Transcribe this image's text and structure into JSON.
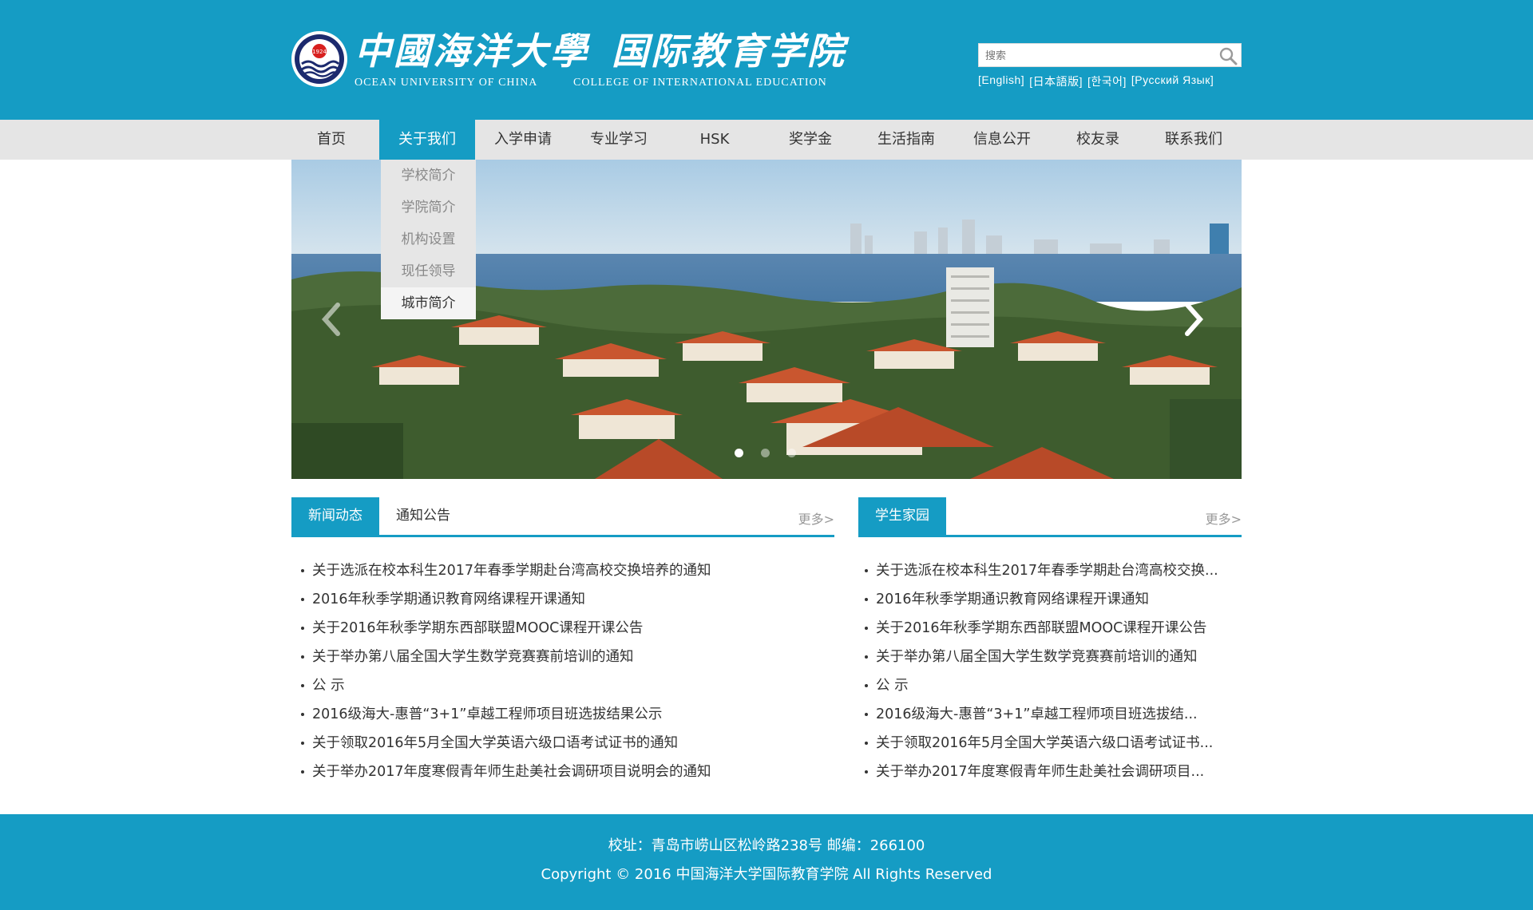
{
  "header": {
    "logo_icon": "university-seal-icon",
    "logo_year": "1924",
    "university_cn": "中國海洋大學",
    "college_cn": "国际教育学院",
    "university_en": "OCEAN UNIVERSITY OF CHINA",
    "college_en": "COLLEGE OF INTERNATIONAL EDUCATION",
    "search_placeholder": "搜索",
    "search_icon": "search-icon",
    "languages": [
      "[English]",
      "[日本語版]",
      "[한국어]",
      "[Русский Язык]"
    ]
  },
  "nav": {
    "items": [
      "首页",
      "关于我们",
      "入学申请",
      "专业学习",
      "HSK",
      "奖学金",
      "生活指南",
      "信息公开",
      "校友录",
      "联系我们"
    ],
    "active_index": 1
  },
  "dropdown": {
    "items": [
      "学校简介",
      "学院简介",
      "机构设置",
      "现任领导",
      "城市简介"
    ],
    "hover_index": 4
  },
  "banner": {
    "prev_icon": "chevron-left-icon",
    "next_icon": "chevron-right-icon",
    "slide_count": 3,
    "active_slide": 0
  },
  "news_panel": {
    "tabs": [
      "新闻动态",
      "通知公告"
    ],
    "active_tab": 0,
    "more": "更多>",
    "items": [
      "关于选派在校本科生2017年春季学期赴台湾高校交换培养的通知",
      "2016年秋季学期通识教育网络课程开课通知",
      "关于2016年秋季学期东西部联盟MOOC课程开课公告",
      "关于举办第八届全国大学生数学竞赛赛前培训的通知",
      "公 示",
      "2016级海大-惠普“3+1”卓越工程师项目班选拔结果公示",
      "关于领取2016年5月全国大学英语六级口语考试证书的通知",
      "关于举办2017年度寒假青年师生赴美社会调研项目说明会的通知"
    ]
  },
  "student_panel": {
    "tabs": [
      "学生家园"
    ],
    "more": "更多>",
    "items": [
      "关于选派在校本科生2017年春季学期赴台湾高校交换...",
      "2016年秋季学期通识教育网络课程开课通知",
      "关于2016年秋季学期东西部联盟MOOC课程开课公告",
      "关于举办第八届全国大学生数学竞赛赛前培训的通知",
      "公 示",
      "2016级海大-惠普“3+1”卓越工程师项目班选拔结...",
      "关于领取2016年5月全国大学英语六级口语考试证书...",
      "关于举办2017年度寒假青年师生赴美社会调研项目..."
    ]
  },
  "footer": {
    "address": "校址：青岛市崂山区松岭路238号  邮编：266100",
    "copyright": "Copyright © 2016 中国海洋大学国际教育学院  All Rights Reserved"
  },
  "colors": {
    "primary": "#159cc4",
    "nav_bg": "#e5e5e5",
    "dropdown_bg": "#e6e6e6"
  }
}
